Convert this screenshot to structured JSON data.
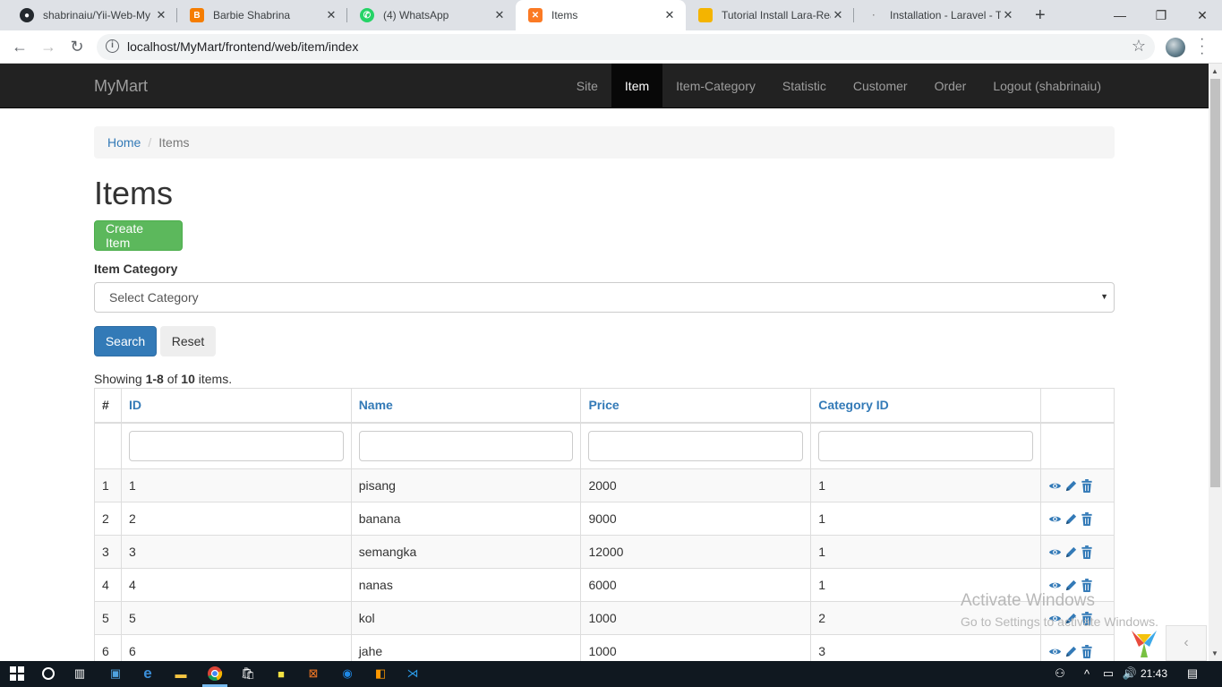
{
  "browser": {
    "tabs": [
      {
        "title": "shabrinaiu/Yii-Web-My",
        "icon": "github-icon",
        "active": false
      },
      {
        "title": "Barbie Shabrina",
        "icon": "blogger-icon",
        "active": false
      },
      {
        "title": "(4) WhatsApp",
        "icon": "whatsapp-icon",
        "active": false
      },
      {
        "title": "Items",
        "icon": "xampp-icon",
        "active": true
      },
      {
        "title": "Tutorial Install Lara-Rea",
        "icon": "slides-icon",
        "active": false
      },
      {
        "title": "Installation - Laravel - T",
        "icon": "laravel-icon",
        "active": false
      }
    ],
    "url": "localhost/MyMart/frontend/web/item/index"
  },
  "navbar": {
    "brand": "MyMart",
    "items": [
      {
        "label": "Site",
        "active": false
      },
      {
        "label": "Item",
        "active": true
      },
      {
        "label": "Item-Category",
        "active": false
      },
      {
        "label": "Statistic",
        "active": false
      },
      {
        "label": "Customer",
        "active": false
      },
      {
        "label": "Order",
        "active": false
      },
      {
        "label": "Logout (shabrinaiu)",
        "active": false
      }
    ]
  },
  "breadcrumb": {
    "home": "Home",
    "current": "Items"
  },
  "page": {
    "title": "Items",
    "create_button": "Create Item",
    "category_label": "Item Category",
    "category_select": "Select Category",
    "search_button": "Search",
    "reset_button": "Reset"
  },
  "summary": {
    "prefix": "Showing ",
    "range": "1-8",
    "of": " of ",
    "total": "10",
    "suffix": " items."
  },
  "table": {
    "columns": [
      "#",
      "ID",
      "Name",
      "Price",
      "Category ID"
    ],
    "rows": [
      {
        "num": "1",
        "id": "1",
        "name": "pisang",
        "price": "2000",
        "category_id": "1"
      },
      {
        "num": "2",
        "id": "2",
        "name": "banana",
        "price": "9000",
        "category_id": "1"
      },
      {
        "num": "3",
        "id": "3",
        "name": "semangka",
        "price": "12000",
        "category_id": "1"
      },
      {
        "num": "4",
        "id": "4",
        "name": "nanas",
        "price": "6000",
        "category_id": "1"
      },
      {
        "num": "5",
        "id": "5",
        "name": "kol",
        "price": "1000",
        "category_id": "2"
      },
      {
        "num": "6",
        "id": "6",
        "name": "jahe",
        "price": "1000",
        "category_id": "3"
      }
    ],
    "action_icons": [
      "eye-icon",
      "pencil-icon",
      "trash-icon"
    ]
  },
  "watermark": {
    "line1": "Activate Windows",
    "line2": "Go to Settings to activate Windows."
  },
  "taskbar": {
    "clock": "21:43"
  },
  "colors": {
    "navbar_bg": "#222222",
    "link": "#337ab7",
    "success": "#5cb85c",
    "primary": "#337ab7"
  }
}
